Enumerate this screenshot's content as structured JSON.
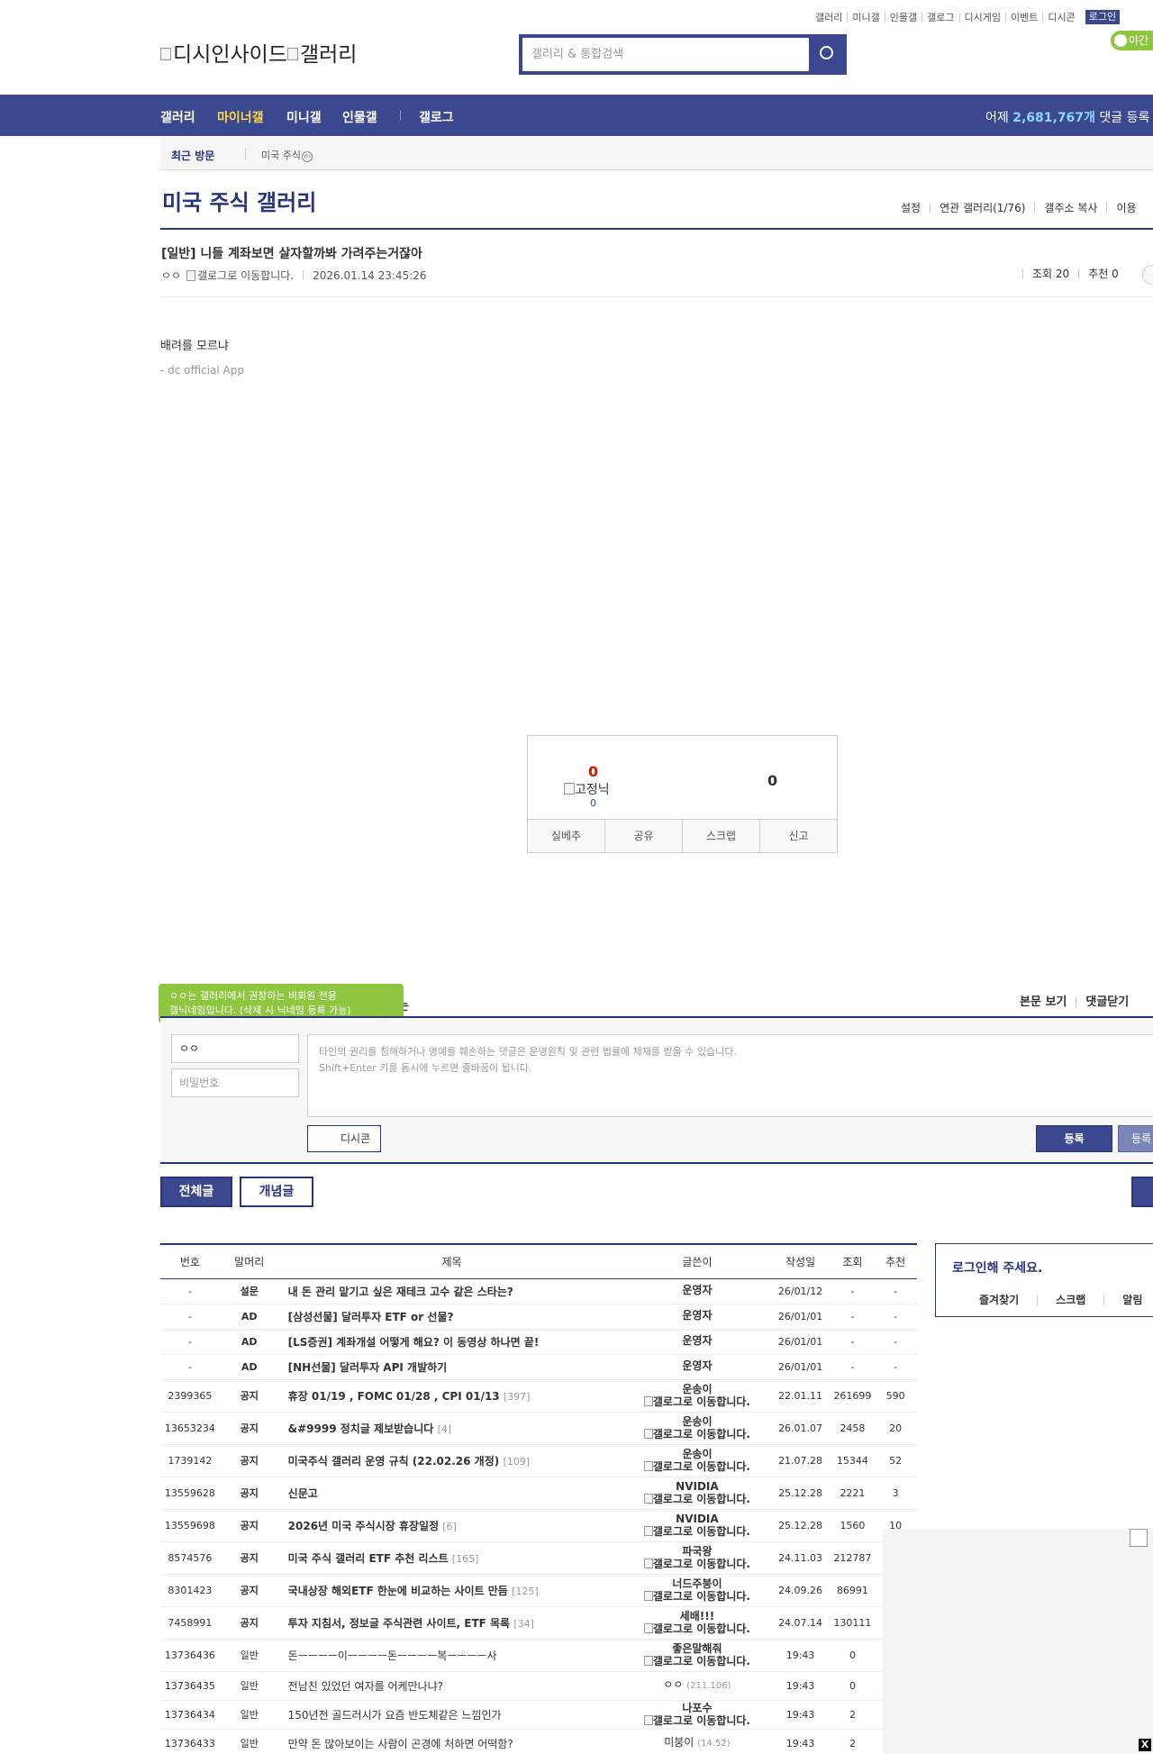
{
  "top_links": [
    "갤러리",
    "미니갤",
    "인물갤",
    "갤로그",
    "디시게임",
    "이벤트",
    "디시콘"
  ],
  "login_label": "로그인",
  "night_label": "야간 모",
  "logo_alt": "디시인사이드",
  "logo_alt2": "갤러리",
  "search": {
    "placeholder": "갤러리 & 통합검색"
  },
  "gnb": {
    "items": [
      "갤러리",
      "마이너갤",
      "미니갤",
      "인물갤",
      "갤로그"
    ],
    "stat_prefix": "어제 ",
    "stat_count": "2,681,767개",
    "stat_suffix": " 댓글 등록"
  },
  "recent": {
    "label": "최근 방문",
    "item": "미국 주식",
    "item_mark": "m"
  },
  "gallery": {
    "title": "미국 주식 갤러리",
    "tools": [
      "설정",
      "연관 갤러리(1/76)",
      "갤주소 복사",
      "이용"
    ]
  },
  "post": {
    "title": "[일반] 니들 계좌보면 살자할까봐 가려주는거잖아",
    "author": "ㅇㅇ",
    "author_img_alt": "갤로그로 이동합니다.",
    "date": "2026.01.14 23:45:26",
    "views": "조회 20",
    "recommends": "추천 0",
    "body": "배려를 모르냐",
    "sign": "- dc official App"
  },
  "vote": {
    "up": "0",
    "fixed_label": "고정닉",
    "fixed_count": "0",
    "down": "0",
    "actions": [
      "실베추",
      "공유",
      "스크랩",
      "신고"
    ]
  },
  "comment": {
    "tooltip_line1": "ㅇㅇ는 갤러리에서 권장하는 비회원 전용",
    "tooltip_line2": "갤닉네임입니다. (삭제 시 닉네임 등록 가능)",
    "header_tail": "는",
    "header_right": [
      "본문 보기",
      "댓글닫기"
    ],
    "name_value": "ㅇㅇ",
    "password_placeholder": "비밀번호",
    "text_line1": "타인의 권리를 침해하거나 명예를 훼손하는 댓글은 운영원칙 및 관련 법률에 제재를 받을 수 있습니다.",
    "text_line2": "Shift+Enter 키를 동시에 누르면 줄바꿈이 됩니다.",
    "dccon_label": "디시콘",
    "submit_label": "등록",
    "submit2_label": "등록"
  },
  "tabs": {
    "all": "전체글",
    "best": "개념글"
  },
  "table": {
    "headers": [
      "번호",
      "말머리",
      "제목",
      "글쓴이",
      "작성일",
      "조회",
      "추천"
    ],
    "rows": [
      {
        "no": "-",
        "head": "설문",
        "title": "내 돈 관리 맡기고 싶은 재테크 고수 같은 스타는?",
        "reply": "",
        "writer": "운영자",
        "writer_note": "",
        "date": "26/01/12",
        "views": "-",
        "rec": "-"
      },
      {
        "no": "-",
        "head": "AD",
        "title": "[삼성선물] 달러투자 ETF or 선물?",
        "reply": "",
        "writer": "운영자",
        "writer_note": "",
        "date": "26/01/01",
        "views": "-",
        "rec": "-"
      },
      {
        "no": "-",
        "head": "AD",
        "title": "[LS증권] 계좌개설 어떻게 해요? 이 동영상 하나면 끝!",
        "reply": "",
        "writer": "운영자",
        "writer_note": "",
        "date": "26/01/01",
        "views": "-",
        "rec": "-"
      },
      {
        "no": "-",
        "head": "AD",
        "title": "[NH선물] 달러투자 API 개발하기",
        "reply": "",
        "writer": "운영자",
        "writer_note": "",
        "date": "26/01/01",
        "views": "-",
        "rec": "-"
      },
      {
        "no": "2399365",
        "head": "공지",
        "title": "휴장 01/19 , FOMC 01/28 , CPI 01/13",
        "reply": "[397]",
        "writer": "운송이",
        "writer_note": "갤로그로 이동합니다.",
        "date": "22.01.11",
        "views": "261699",
        "rec": "590"
      },
      {
        "no": "13653234",
        "head": "공지",
        "title": "&#9999 정치글 제보받습니다",
        "reply": "[4]",
        "writer": "운송이",
        "writer_note": "갤로그로 이동합니다.",
        "date": "26.01.07",
        "views": "2458",
        "rec": "20"
      },
      {
        "no": "1739142",
        "head": "공지",
        "title": "미국주식 갤러리 운영 규칙 (22.02.26 개정)",
        "reply": "[109]",
        "writer": "운송이",
        "writer_note": "갤로그로 이동합니다.",
        "date": "21.07.28",
        "views": "15344",
        "rec": "52"
      },
      {
        "no": "13559628",
        "head": "공지",
        "title": "신문고",
        "reply": "",
        "writer": "NVIDIA",
        "writer_note": "갤로그로 이동합니다.",
        "date": "25.12.28",
        "views": "2221",
        "rec": "3"
      },
      {
        "no": "13559698",
        "head": "공지",
        "title": "2026년 미국 주식시장 휴장일정",
        "reply": "[6]",
        "writer": "NVIDIA",
        "writer_note": "갤로그로 이동합니다.",
        "date": "25.12.28",
        "views": "1560",
        "rec": "10"
      },
      {
        "no": "8574576",
        "head": "공지",
        "title": "미국 주식 갤러리 ETF 추천 리스트",
        "reply": "[165]",
        "writer": "파국왕",
        "writer_note": "갤로그로 이동합니다.",
        "date": "24.11.03",
        "views": "212787",
        "rec": ""
      },
      {
        "no": "8301423",
        "head": "공지",
        "title": "국내상장 해외ETF 한눈에 비교하는 사이트 만듬",
        "reply": "[125]",
        "writer": "너드주붕이",
        "writer_note": "갤로그로 이동합니다.",
        "date": "24.09.26",
        "views": "86991",
        "rec": ""
      },
      {
        "no": "7458991",
        "head": "공지",
        "title": "투자 지침서, 정보글 주식관련 사이트, ETF 목록",
        "reply": "[34]",
        "writer": "세배!!!",
        "writer_note": "갤로그로 이동합니다.",
        "date": "24.07.14",
        "views": "130111",
        "rec": ""
      },
      {
        "no": "13736436",
        "head": "일반",
        "title": "돈ㅡㅡㅡㅡ이ㅡㅡㅡㅡ돈ㅡㅡㅡㅡ복ㅡㅡㅡㅡ사",
        "reply": "",
        "writer": "좋은말해줘",
        "writer_note": "갤로그로 이동합니다.",
        "date": "19:43",
        "views": "0",
        "rec": ""
      },
      {
        "no": "13736435",
        "head": "일반",
        "title": "전남친 있었던 여자를 어케만나냐?",
        "reply": "",
        "writer": "ㅇㅇ",
        "writer_note": "(211.106)",
        "date": "19:43",
        "views": "0",
        "rec": ""
      },
      {
        "no": "13736434",
        "head": "일반",
        "title": "150년전 골드러시가 요즘 반도체같은 느낌인가",
        "reply": "",
        "writer": "나포수",
        "writer_note": "갤로그로 이동합니다.",
        "date": "19:43",
        "views": "2",
        "rec": ""
      },
      {
        "no": "13736433",
        "head": "일반",
        "title": "만약 돈 많아보이는 사람이 곤경에 처하면 어떡함?",
        "reply": "",
        "writer": "미붕이",
        "writer_note": "(14.52)",
        "date": "19:43",
        "views": "2",
        "rec": ""
      }
    ]
  },
  "side": {
    "title": "로그인해 주세요.",
    "links": [
      "즐겨찾기",
      "스크랩",
      "알림"
    ]
  },
  "close_label": "X"
}
